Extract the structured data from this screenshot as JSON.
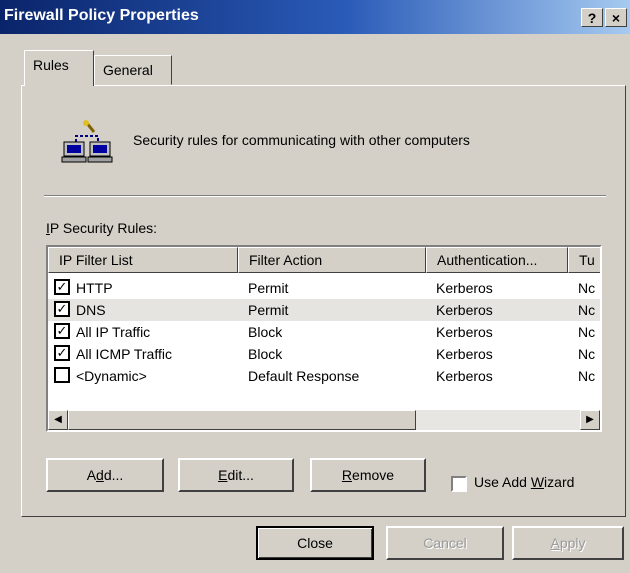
{
  "window": {
    "title": "Firewall Policy Properties",
    "help_label": "?",
    "close_label": "×"
  },
  "tabs": [
    {
      "label": "Rules",
      "selected": true
    },
    {
      "label": "General",
      "selected": false
    }
  ],
  "header": {
    "description": "Security rules for communicating with other computers",
    "icon": "computers-network-icon"
  },
  "rules_list": {
    "label_mnemonic": "I",
    "label_rest": "P Security Rules:",
    "columns": [
      "IP Filter List",
      "Filter Action",
      "Authentication...",
      "Tu"
    ],
    "rows": [
      {
        "checked": true,
        "filter_list": "HTTP",
        "filter_action": "Permit",
        "authentication": "Kerberos",
        "tunnel": "Nc"
      },
      {
        "checked": true,
        "filter_list": "DNS",
        "filter_action": "Permit",
        "authentication": "Kerberos",
        "tunnel": "Nc"
      },
      {
        "checked": true,
        "filter_list": "All IP Traffic",
        "filter_action": "Block",
        "authentication": "Kerberos",
        "tunnel": "Nc"
      },
      {
        "checked": true,
        "filter_list": "All ICMP Traffic",
        "filter_action": "Block",
        "authentication": "Kerberos",
        "tunnel": "Nc"
      },
      {
        "checked": false,
        "filter_list": "<Dynamic>",
        "filter_action": "Default Response",
        "authentication": "Kerberos",
        "tunnel": "Nc"
      }
    ],
    "scroll_left_icon": "arrow-left-icon",
    "scroll_right_icon": "arrow-right-icon"
  },
  "actions": {
    "add": {
      "pre": "A",
      "mnemonic": "d",
      "post": "d..."
    },
    "edit": {
      "pre": "",
      "mnemonic": "E",
      "post": "dit..."
    },
    "remove": {
      "pre": "",
      "mnemonic": "R",
      "post": "emove"
    },
    "use_wizard": {
      "checked": false,
      "pre": "Use Add ",
      "mnemonic": "W",
      "post": "izard"
    }
  },
  "footer": {
    "close_label": "Close",
    "cancel_label": "Cancel",
    "apply_label": "Apply",
    "apply_mnemonic": "A",
    "apply_rest": "pply"
  },
  "colors": {
    "titlebar_start": "#0a246a",
    "titlebar_end": "#a6caf0",
    "face": "#d4d0c8"
  }
}
